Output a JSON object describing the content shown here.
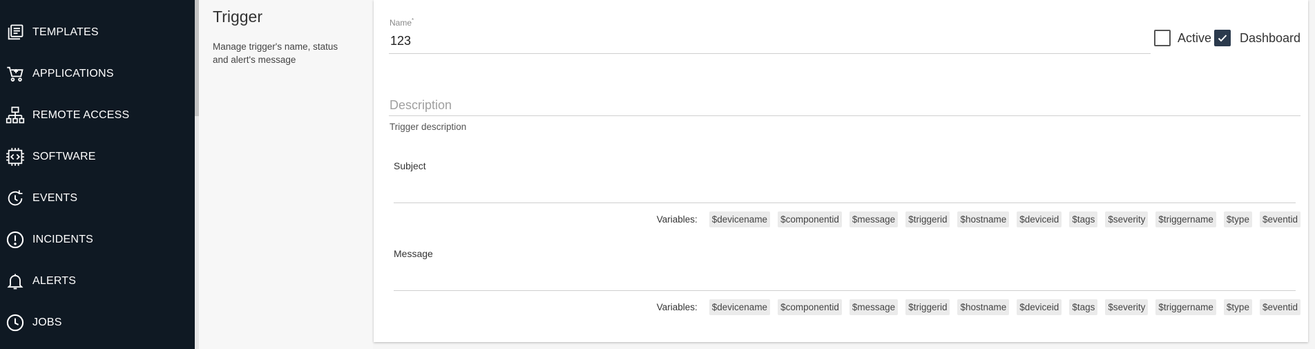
{
  "sidebar": {
    "items": [
      {
        "label": "TEMPLATES",
        "icon": "templates-icon"
      },
      {
        "label": "APPLICATIONS",
        "icon": "cart-icon"
      },
      {
        "label": "REMOTE ACCESS",
        "icon": "network-icon"
      },
      {
        "label": "SOFTWARE",
        "icon": "chip-code-icon"
      },
      {
        "label": "EVENTS",
        "icon": "history-icon"
      },
      {
        "label": "INCIDENTS",
        "icon": "alert-circle-icon"
      },
      {
        "label": "ALERTS",
        "icon": "bell-icon"
      },
      {
        "label": "JOBS",
        "icon": "clock-icon"
      }
    ]
  },
  "section": {
    "title": "Trigger",
    "description": "Manage trigger's name, status and alert's message"
  },
  "form": {
    "name_label": "Name",
    "name_required_mark": "*",
    "name_value": "123",
    "active_label": "Active",
    "active_checked": false,
    "dashboard_label": "Dashboard",
    "dashboard_checked": true,
    "description_placeholder": "Description",
    "description_helper": "Trigger description",
    "subject_label": "Subject",
    "message_label": "Message",
    "variables_label": "Variables:",
    "variables": [
      "$devicename",
      "$componentid",
      "$message",
      "$triggerid",
      "$hostname",
      "$deviceid",
      "$tags",
      "$severity",
      "$triggername",
      "$type",
      "$eventid"
    ]
  },
  "colors": {
    "sidebar_bg": "#0f1923",
    "checkbox_checked": "#2b3a4d"
  }
}
